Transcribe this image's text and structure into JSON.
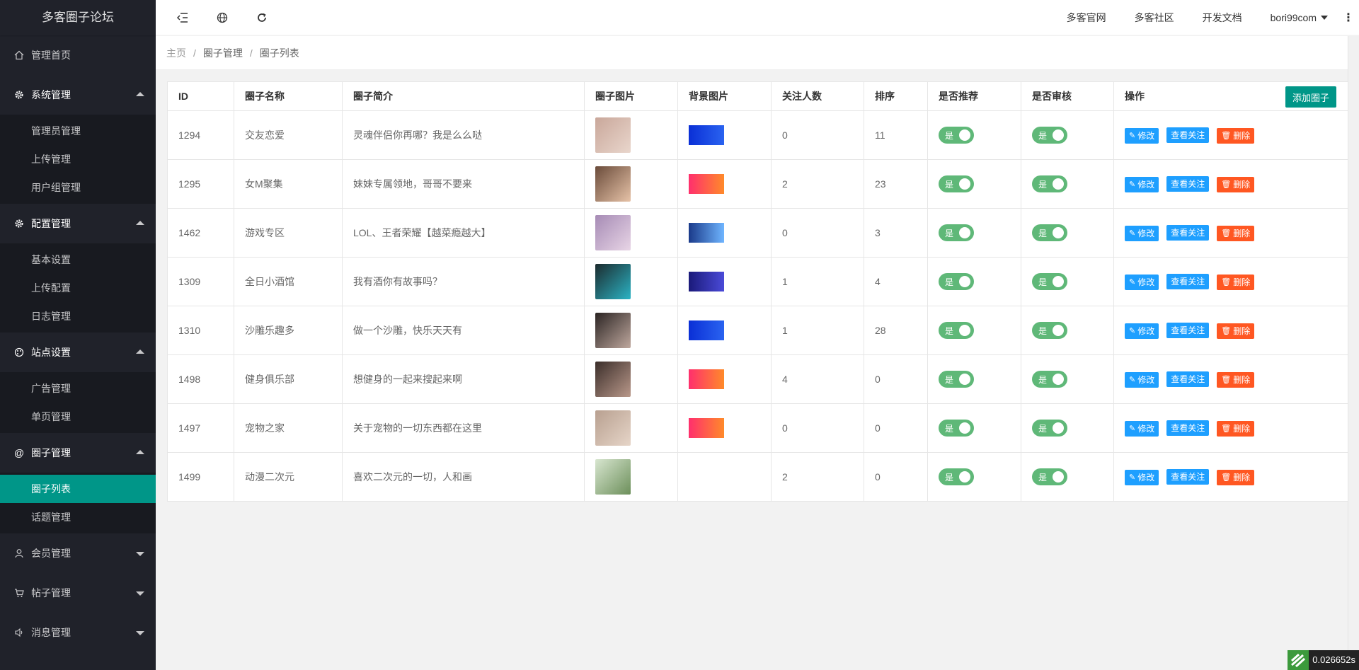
{
  "app": {
    "title": "多客圈子论坛"
  },
  "sidebar": {
    "home": {
      "label": "管理首页",
      "icon": "home-icon"
    },
    "groups": [
      {
        "label": "系统管理",
        "icon": "gear-icon",
        "open": true,
        "items": [
          {
            "label": "管理员管理"
          },
          {
            "label": "上传管理"
          },
          {
            "label": "用户组管理"
          }
        ]
      },
      {
        "label": "配置管理",
        "icon": "gear-icon",
        "open": true,
        "items": [
          {
            "label": "基本设置"
          },
          {
            "label": "上传配置"
          },
          {
            "label": "日志管理"
          }
        ]
      },
      {
        "label": "站点设置",
        "icon": "palette-icon",
        "open": true,
        "items": [
          {
            "label": "广告管理"
          },
          {
            "label": "单页管理"
          }
        ]
      },
      {
        "label": "圈子管理",
        "icon": "at-icon",
        "open": true,
        "items": [
          {
            "label": "圈子列表",
            "active": true
          },
          {
            "label": "话题管理"
          }
        ]
      },
      {
        "label": "会员管理",
        "icon": "user-icon",
        "open": false,
        "items": []
      },
      {
        "label": "帖子管理",
        "icon": "cart-icon",
        "open": false,
        "items": []
      },
      {
        "label": "消息管理",
        "icon": "speaker-icon",
        "open": false,
        "items": []
      }
    ]
  },
  "header": {
    "links": [
      "多客官网",
      "多客社区",
      "开发文档"
    ],
    "user": "bori99com",
    "more": "⋮"
  },
  "breadcrumb": [
    "主页",
    "圈子管理",
    "圈子列表"
  ],
  "table": {
    "columns": [
      "ID",
      "圈子名称",
      "圈子简介",
      "圈子图片",
      "背景图片",
      "关注人数",
      "排序",
      "是否推荐",
      "是否审核",
      "操作"
    ],
    "add_button": "添加圈子",
    "actions": {
      "edit": "修改",
      "view": "查看关注",
      "delete": "删除"
    },
    "switch_label": "是",
    "rows": [
      {
        "id": "1294",
        "name": "交友恋爱",
        "desc": "灵魂伴侣你再哪？我是么么哒",
        "followers": "0",
        "sort": "11",
        "thumb": [
          "#c9a79a",
          "#e9d6cc"
        ],
        "bg": [
          "#0a2fd6",
          "#2a63f0"
        ]
      },
      {
        "id": "1295",
        "name": "女M聚集",
        "desc": "妹妹专属领地，哥哥不要来",
        "followers": "2",
        "sort": "23",
        "thumb": [
          "#6a4b3a",
          "#e7c3a8"
        ],
        "bg": [
          "#ff2f6d",
          "#ff8a2a"
        ]
      },
      {
        "id": "1462",
        "name": "游戏专区",
        "desc": "LOL、王者荣耀【越菜瘾越大】",
        "followers": "0",
        "sort": "3",
        "thumb": [
          "#a68bb5",
          "#e8d5e6"
        ],
        "bg": [
          "#1a3a8a",
          "#6fb5ff"
        ]
      },
      {
        "id": "1309",
        "name": "全日小酒馆",
        "desc": "我有酒你有故事吗？",
        "followers": "1",
        "sort": "4",
        "thumb": [
          "#1c2b2e",
          "#2bb3c4"
        ],
        "bg": [
          "#1b1a7a",
          "#4a4ad8"
        ]
      },
      {
        "id": "1310",
        "name": "沙雕乐趣多",
        "desc": "做一个沙雕，快乐天天有",
        "followers": "1",
        "sort": "28",
        "thumb": [
          "#2b2423",
          "#bfa89e"
        ],
        "bg": [
          "#0a2fd6",
          "#2a63f0"
        ]
      },
      {
        "id": "1498",
        "name": "健身俱乐部",
        "desc": "想健身的一起来搜起来啊",
        "followers": "4",
        "sort": "0",
        "thumb": [
          "#3b2e2a",
          "#b9988a"
        ],
        "bg": [
          "#ff2f6d",
          "#ff8a2a"
        ]
      },
      {
        "id": "1497",
        "name": "宠物之家",
        "desc": "关于宠物的一切东西都在这里",
        "followers": "0",
        "sort": "0",
        "thumb": [
          "#b8a090",
          "#e6d5c8"
        ],
        "bg": [
          "#ff2f6d",
          "#ff8a2a"
        ]
      },
      {
        "id": "1499",
        "name": "动漫二次元",
        "desc": "喜欢二次元的一切，人和画",
        "followers": "2",
        "sort": "0",
        "thumb": [
          "#d8e6d0",
          "#6c8f5a"
        ],
        "bg": null
      }
    ]
  },
  "timer": {
    "value": "0.026652s"
  }
}
